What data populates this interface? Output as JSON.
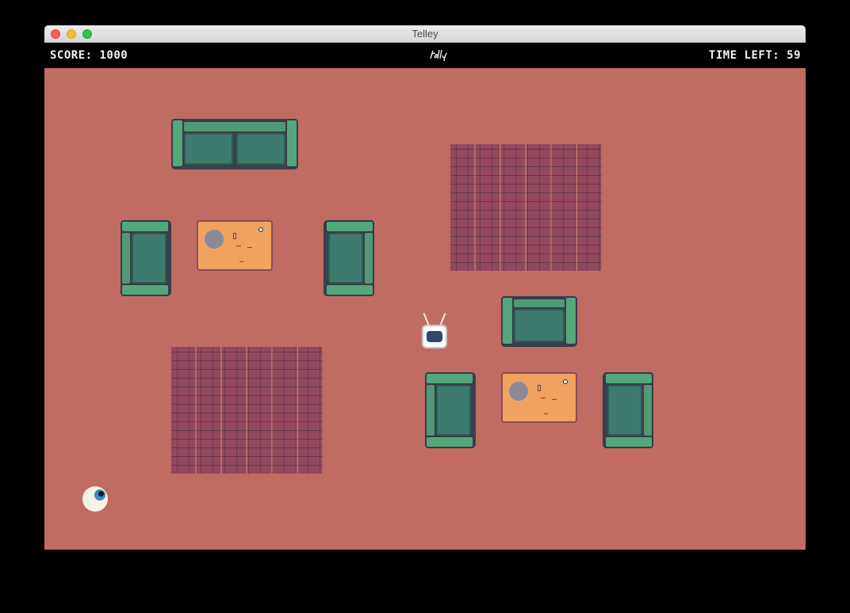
{
  "window": {
    "title": "Telley"
  },
  "hud": {
    "score_text": "SCORE: 1000",
    "time_text": "TIME LEFT: 59",
    "logo": "telley-logo-icon"
  },
  "colors": {
    "floor": "#c06c62",
    "rug": "#94485e",
    "sofa": "#4f9a72",
    "table": "#f0a35e",
    "tv_screen": "#2e4870",
    "eye_iris": "#3d88c8"
  },
  "scene": {
    "sofas": [
      "sofa-long",
      "armchair-left-1",
      "armchair-right-1",
      "armchair-center-2",
      "armchair-left-2",
      "armchair-right-2"
    ],
    "rugs": [
      "rug-top-right",
      "rug-bottom-left"
    ],
    "tables": [
      "coffee-table-1",
      "coffee-table-2"
    ],
    "player": "tv-player",
    "enemy": "eyeball"
  }
}
